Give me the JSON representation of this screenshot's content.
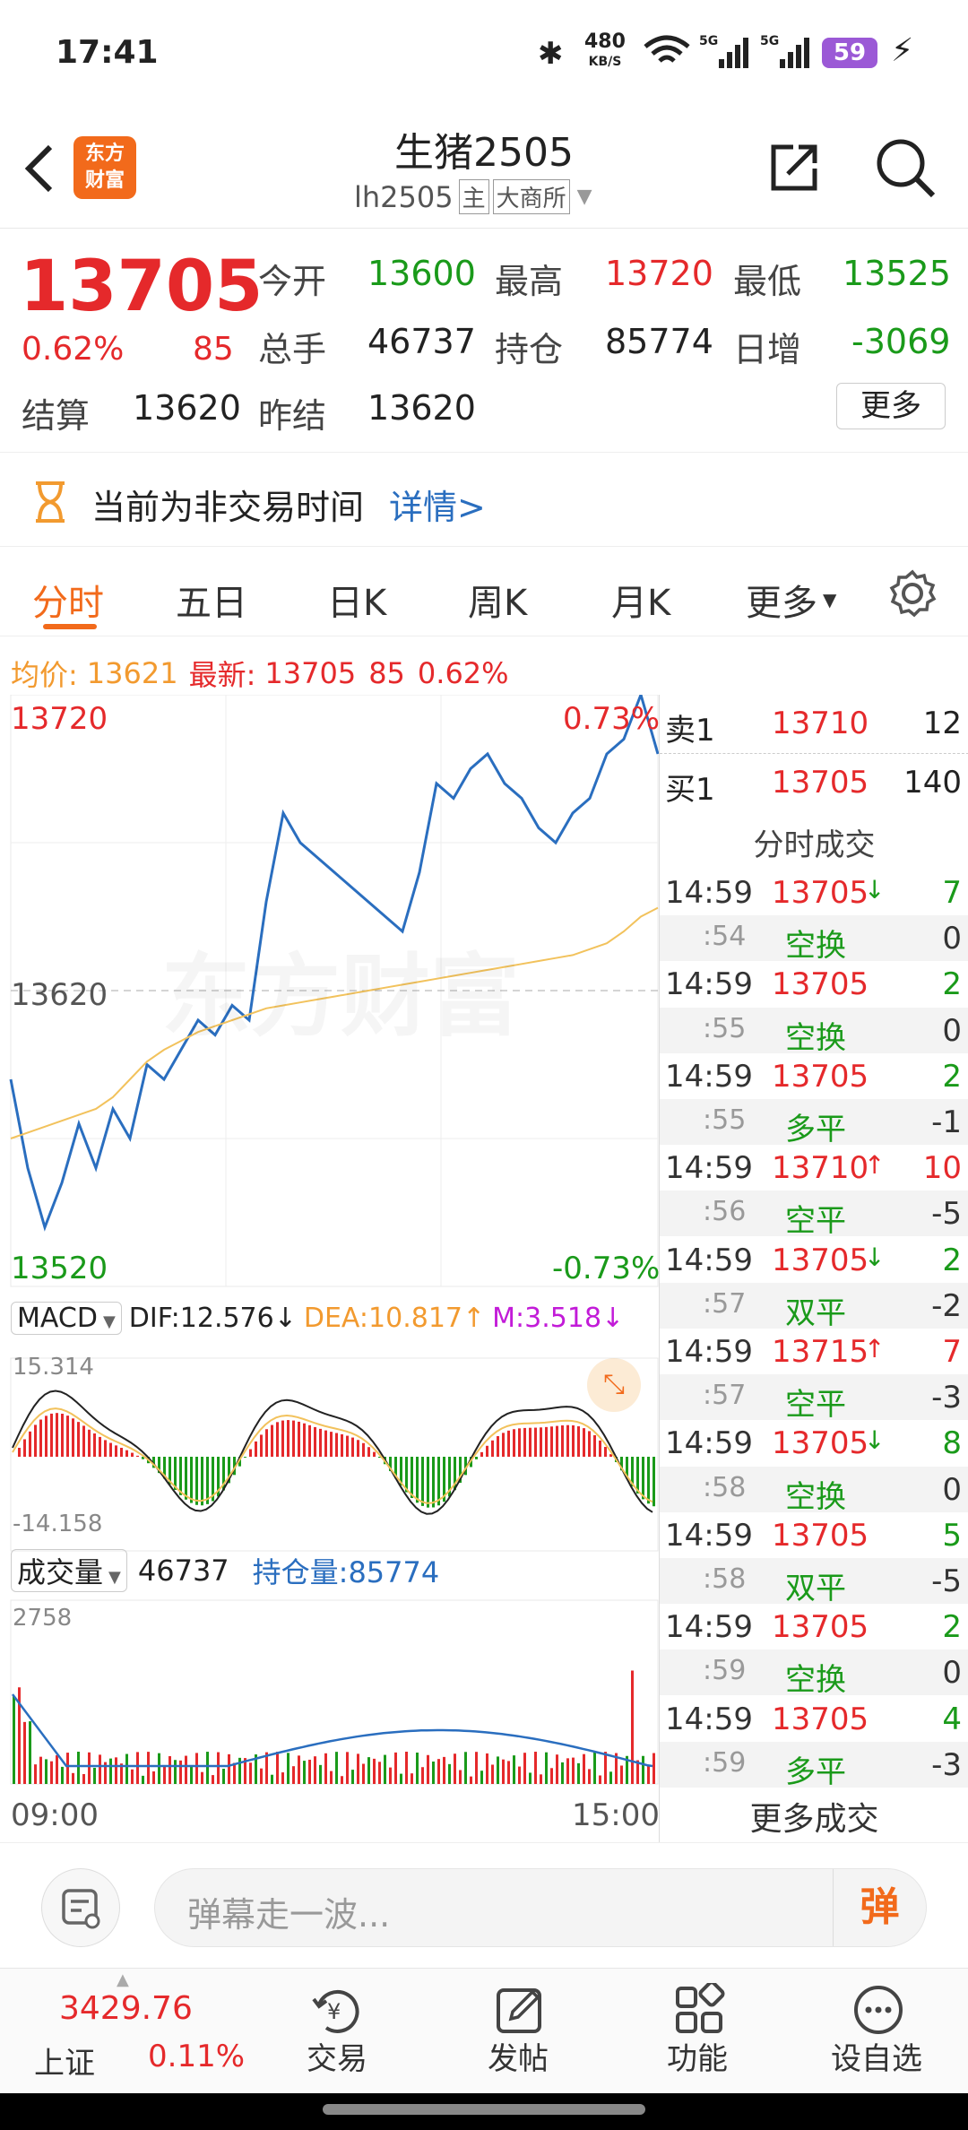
{
  "status": {
    "time": "17:41",
    "net_speed": "480",
    "net_unit": "KB/S",
    "battery": "59"
  },
  "header": {
    "title": "生猪2505",
    "code": "lh2505",
    "tag_main": "主",
    "tag_exchange": "大商所",
    "logo_line1": "东方",
    "logo_line2": "财富"
  },
  "quote": {
    "price": "13705",
    "pct": "0.62%",
    "change": "85",
    "items": [
      {
        "label": "今开",
        "value": "13600"
      },
      {
        "label": "最高",
        "value": "13720"
      },
      {
        "label": "最低",
        "value": "13525"
      },
      {
        "label": "总手",
        "value": "46737"
      },
      {
        "label": "持仓",
        "value": "85774"
      },
      {
        "label": "日增",
        "value": "-3069"
      },
      {
        "label": "结算",
        "value": "13620"
      },
      {
        "label": "昨结",
        "value": "13620"
      }
    ],
    "more": "更多"
  },
  "notice": {
    "text": "当前为非交易时间",
    "link": "详情>"
  },
  "tabs": [
    "分时",
    "五日",
    "日K",
    "周K",
    "月K",
    "更多"
  ],
  "info_line": {
    "avg_label": "均价:",
    "avg": "13621",
    "latest_label": "最新:",
    "latest": "13705",
    "change": "85",
    "pct": "0.62%"
  },
  "chart": {
    "y_top": "13720",
    "y_mid": "13620",
    "y_bot": "13520",
    "pct_top": "0.73%",
    "pct_bot": "-0.73%",
    "watermark": "东方财富",
    "x_start": "09:00",
    "x_end": "15:00",
    "macd": {
      "label": "MACD",
      "dif": "DIF:12.576",
      "dea": "DEA:10.817",
      "m": "M:3.518",
      "top": "15.314",
      "bot": "-14.158"
    },
    "volume": {
      "label": "成交量",
      "value": "46737",
      "oi": "持仓量:85774",
      "top": "2758"
    }
  },
  "chart_data": {
    "type": "line",
    "x_start": "09:00",
    "x_end": "15:00",
    "ylim": [
      13520,
      13720
    ],
    "series": [
      {
        "values": [
          13590,
          13560,
          13540,
          13555,
          13575,
          13560,
          13580,
          13570,
          13595,
          13590,
          13600,
          13610,
          13605,
          13615,
          13610,
          13650,
          13680,
          13670,
          13665,
          13660,
          13655,
          13650,
          13645,
          13640,
          13660,
          13690,
          13685,
          13695,
          13700,
          13690,
          13685,
          13675,
          13670,
          13680,
          13685,
          13700,
          13705,
          13720,
          13700
        ]
      },
      {
        "values": [
          13570,
          13572,
          13574,
          13576,
          13578,
          13580,
          13584,
          13590,
          13596,
          13600,
          13603,
          13606,
          13608,
          13610,
          13612,
          13614,
          13615,
          13616,
          13617,
          13618,
          13619,
          13620,
          13621,
          13622,
          13623,
          13624,
          13625,
          13626,
          13627,
          13628,
          13629,
          13630,
          13631,
          13632,
          13634,
          13636,
          13640,
          13645,
          13648
        ]
      }
    ]
  },
  "book": {
    "sell": {
      "label": "卖1",
      "price": "13710",
      "vol": "12"
    },
    "buy": {
      "label": "买1",
      "price": "13705",
      "vol": "140"
    }
  },
  "trades_title": "分时成交",
  "trades": [
    {
      "t": "14:59",
      "p": "13705",
      "arrow": "↓",
      "v": "7"
    },
    {
      "t": ":54",
      "p": "空换",
      "v": "0"
    },
    {
      "t": "14:59",
      "p": "13705",
      "arrow": "",
      "v": "2"
    },
    {
      "t": ":55",
      "p": "空换",
      "v": "0"
    },
    {
      "t": "14:59",
      "p": "13705",
      "arrow": "",
      "v": "2"
    },
    {
      "t": ":55",
      "p": "多平",
      "v": "-1"
    },
    {
      "t": "14:59",
      "p": "13710",
      "arrow": "↑",
      "v": "10"
    },
    {
      "t": ":56",
      "p": "空平",
      "v": "-5"
    },
    {
      "t": "14:59",
      "p": "13705",
      "arrow": "↓",
      "v": "2"
    },
    {
      "t": ":57",
      "p": "双平",
      "v": "-2"
    },
    {
      "t": "14:59",
      "p": "13715",
      "arrow": "↑",
      "v": "7"
    },
    {
      "t": ":57",
      "p": "空平",
      "v": "-3"
    },
    {
      "t": "14:59",
      "p": "13705",
      "arrow": "↓",
      "v": "8"
    },
    {
      "t": ":58",
      "p": "空换",
      "v": "0"
    },
    {
      "t": "14:59",
      "p": "13705",
      "arrow": "",
      "v": "5"
    },
    {
      "t": ":58",
      "p": "双平",
      "v": "-5"
    },
    {
      "t": "14:59",
      "p": "13705",
      "arrow": "",
      "v": "2"
    },
    {
      "t": ":59",
      "p": "空换",
      "v": "0"
    },
    {
      "t": "14:59",
      "p": "13705",
      "arrow": "",
      "v": "4"
    },
    {
      "t": ":59",
      "p": "多平",
      "v": "-3"
    }
  ],
  "more_trades": "更多成交",
  "comment": {
    "placeholder": "弹幕走一波...",
    "danmu": "弹"
  },
  "bottom_nav": {
    "index_value": "3429.76",
    "index_name": "上证",
    "index_pct": "0.11%",
    "items": [
      "交易",
      "发帖",
      "功能",
      "设自选"
    ]
  }
}
